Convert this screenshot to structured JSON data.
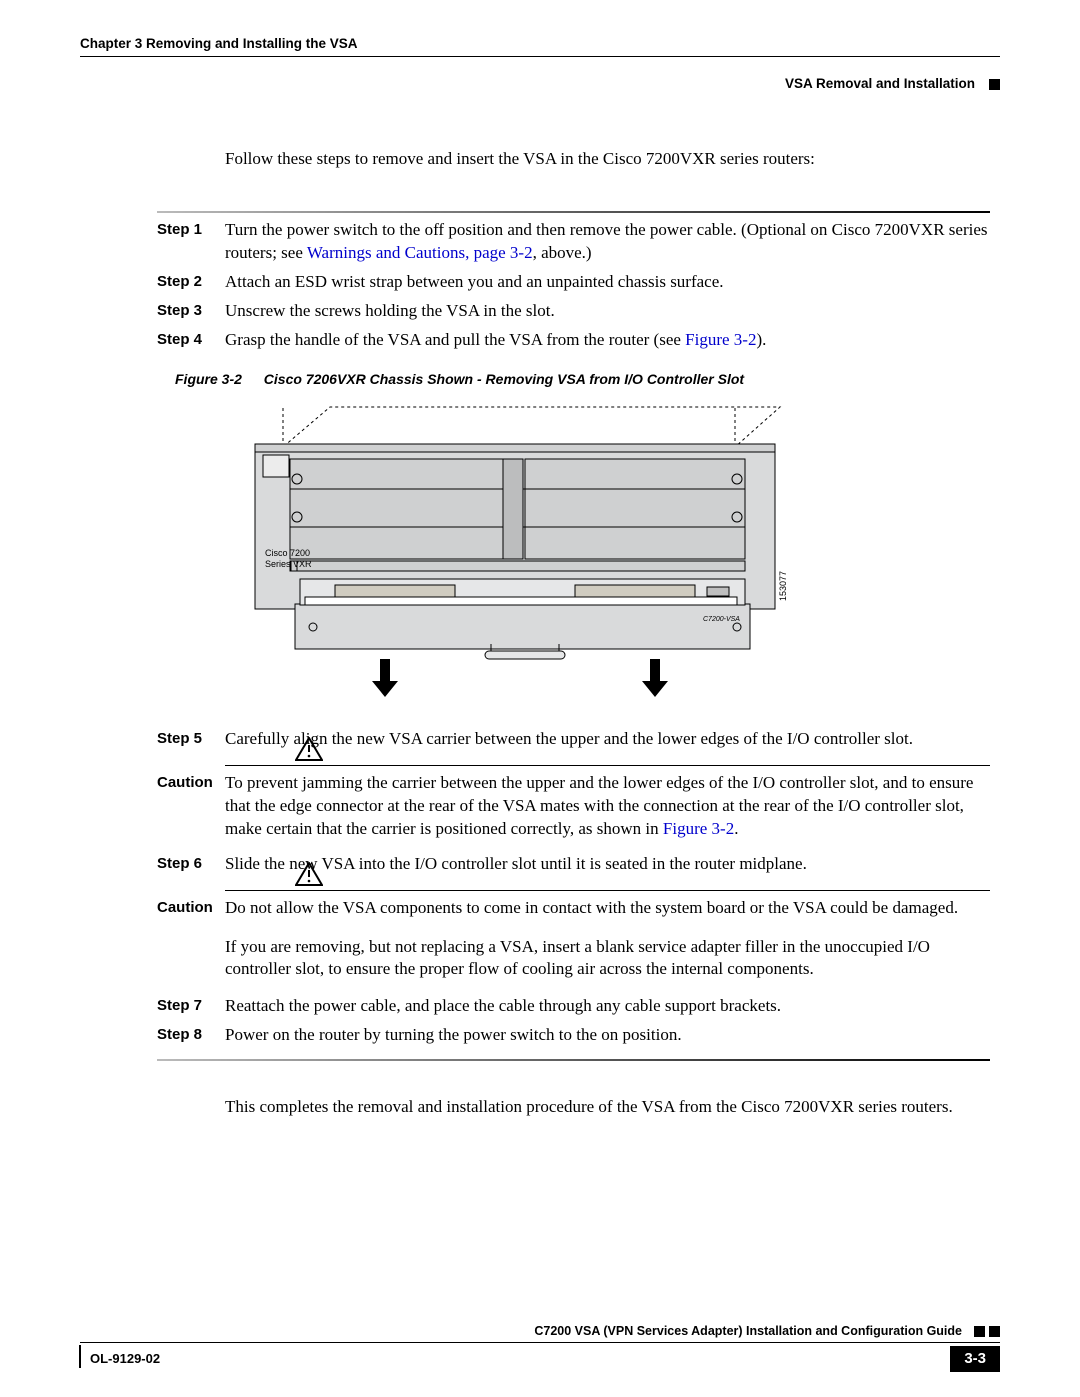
{
  "header": {
    "chapter": "Chapter 3      Removing and Installing the VSA",
    "section": "VSA Removal and Installation"
  },
  "intro": "Follow these steps to remove and insert the VSA in the Cisco 7200VXR series routers:",
  "steps": {
    "s1": {
      "label": "Step 1",
      "text_a": "Turn the power switch to the off position and then remove the power cable. (Optional on Cisco 7200VXR series routers; see ",
      "link": "Warnings and Cautions, page 3-2",
      "text_b": ", above.)"
    },
    "s2": {
      "label": "Step 2",
      "text": "Attach an ESD wrist strap between you and an unpainted chassis surface."
    },
    "s3": {
      "label": "Step 3",
      "text": "Unscrew the screws holding the VSA in the slot."
    },
    "s4": {
      "label": "Step 4",
      "text_a": "Grasp the handle of the VSA and pull the VSA from the router (see ",
      "link": "Figure 3-2",
      "text_b": ")."
    },
    "s5": {
      "label": "Step 5",
      "text": "Carefully align the new VSA carrier between the upper and the lower edges of the I/O controller slot."
    },
    "s6": {
      "label": "Step 6",
      "text": "Slide the new VSA into the I/O controller slot until it is seated in the router midplane."
    },
    "s7": {
      "label": "Step 7",
      "text": "Reattach the power cable, and place the cable through any cable support brackets."
    },
    "s8": {
      "label": "Step 8",
      "text": "Power on the router by turning the power switch to the on position."
    }
  },
  "cautions": {
    "label": "Caution",
    "c1": {
      "text_a": "To prevent jamming the carrier between the upper and the lower edges of the I/O controller slot, and to ensure that the edge connector at the rear of the VSA mates with the connection at the rear of the I/O controller slot, make certain that the carrier is positioned correctly, as shown in ",
      "link": "Figure 3-2",
      "text_b": "."
    },
    "c2": {
      "text": "Do not allow the VSA components to come in contact with the system board or the VSA could be damaged."
    },
    "c2_extra": "If you are removing, but not replacing a VSA, insert a blank service adapter filler in the unoccupied I/O controller slot, to ensure the proper flow of cooling air across the internal components."
  },
  "figure": {
    "number": "Figure 3-2",
    "title": "Cisco 7206VXR Chassis Shown - Removing VSA from I/O Controller Slot",
    "chassis_label_1": "Cisco 7200",
    "chassis_label_2": "Series VXR",
    "side_id": "153077",
    "card_label": "C7200-VSA"
  },
  "closing": "This completes the removal and installation procedure of the VSA from the Cisco 7200VXR series routers.",
  "footer": {
    "guide": "C7200 VSA (VPN Services Adapter) Installation and Configuration Guide",
    "ol": "OL-9129-02",
    "page": "3-3"
  }
}
